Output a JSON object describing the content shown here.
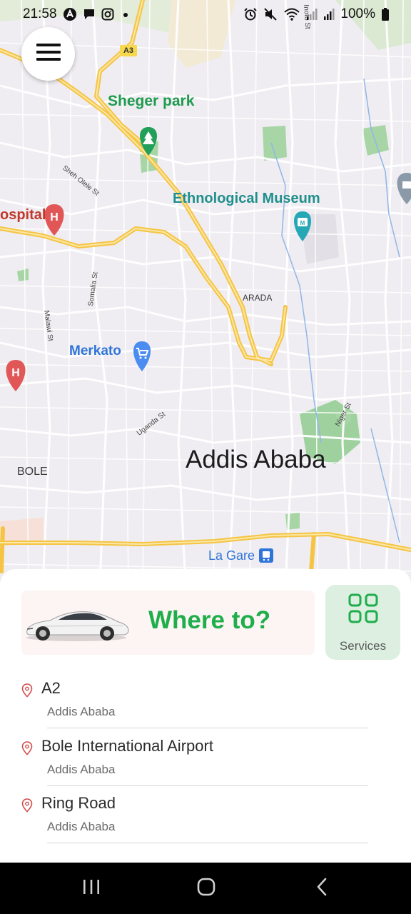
{
  "status_bar": {
    "time": "21:58",
    "battery": "100%",
    "left_icons": [
      "notification-a-icon",
      "message-icon",
      "instagram-icon",
      "dot-icon"
    ],
    "right_icons": [
      "alarm-icon",
      "mute-icon",
      "wifi-icon",
      "signal-icon",
      "signal-icon",
      "battery-icon"
    ]
  },
  "map": {
    "labels": {
      "park": "Sheger park",
      "museum": "Ethnological Museum",
      "hospital": "ospital",
      "merkato": "Merkato",
      "arada": "ARADA",
      "bole": "BOLE",
      "city": "Addis Ababa",
      "station": "La Gare",
      "highway": "A3"
    },
    "streets": {
      "sheh_olele": "Sheh Olele St",
      "somalia": "Somalia St",
      "malawi": "Malawi St",
      "uganda": "Uganda St",
      "niger": "Niger St",
      "intoto": "Inoto St"
    },
    "colors": {
      "park_text": "#1f9b4f",
      "museum_text": "#1f8f8c",
      "hospital_text": "#c0392b",
      "poi_blue": "#2f74d9",
      "highway": "#f5c443"
    }
  },
  "sheet": {
    "where_to": "Where to?",
    "services": "Services",
    "accent": "#1fae4b",
    "recent": [
      {
        "title": "A2",
        "subtitle": "Addis Ababa"
      },
      {
        "title": "Bole International Airport",
        "subtitle": "Addis Ababa"
      },
      {
        "title": "Ring Road",
        "subtitle": "Addis Ababa"
      }
    ]
  },
  "nav": {
    "buttons": [
      "recent-apps-icon",
      "home-icon",
      "back-icon"
    ]
  }
}
